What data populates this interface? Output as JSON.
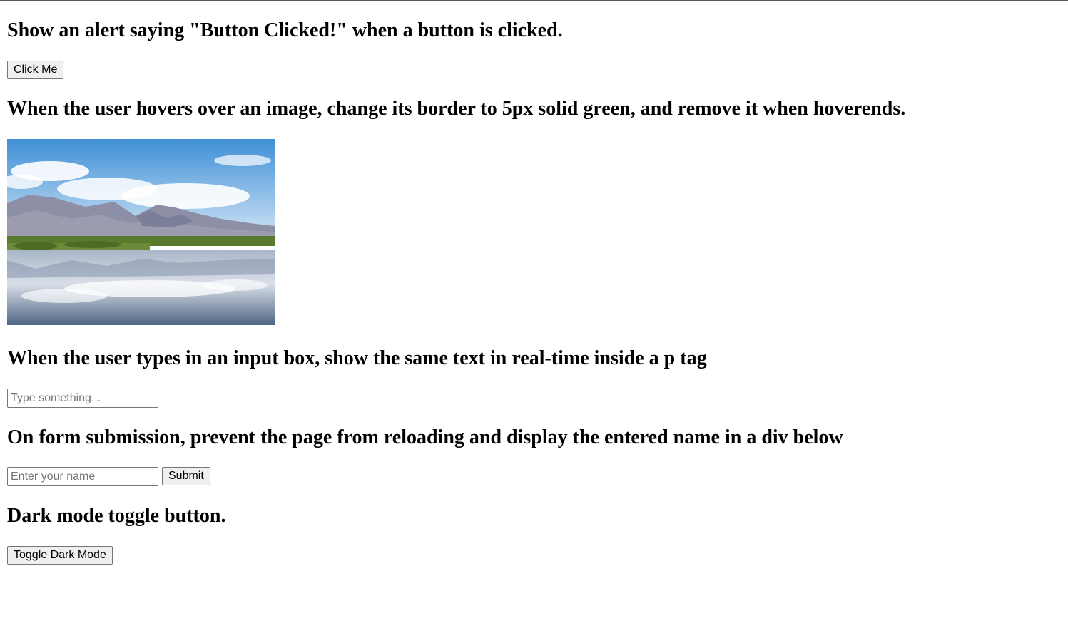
{
  "sections": {
    "alert": {
      "heading": "Show an alert saying \"Button Clicked!\" when a button is clicked.",
      "button_label": "Click Me"
    },
    "hover": {
      "heading": "When the user hovers over an image, change its border to 5px solid green, and remove it when hoverends."
    },
    "mirror": {
      "heading": "When the user types in an input box, show the same text in real-time inside a p tag",
      "input_placeholder": "Type something...",
      "input_value": ""
    },
    "form": {
      "heading": "On form submission, prevent the page from reloading and display the entered name in a div below",
      "input_placeholder": "Enter your name",
      "input_value": "",
      "submit_label": "Submit"
    },
    "dark": {
      "heading": "Dark mode toggle button.",
      "button_label": "Toggle Dark Mode"
    }
  },
  "colors": {
    "sky_top": "#3f8fd6",
    "sky_bottom": "#dcebf8",
    "mountain": "#8d8fa6",
    "vegetation": "#5a7a2e",
    "water": "#6a7f9c"
  }
}
